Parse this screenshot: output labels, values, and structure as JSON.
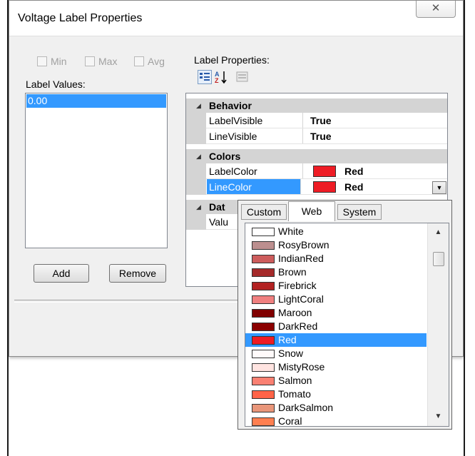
{
  "window": {
    "title": "Voltage Label Properties",
    "close_glyph": "✕"
  },
  "checkboxes": [
    {
      "label": "Min",
      "checked": false,
      "enabled": false
    },
    {
      "label": "Max",
      "checked": false,
      "enabled": false
    },
    {
      "label": "Avg",
      "checked": false,
      "enabled": false
    }
  ],
  "label_values": {
    "heading": "Label Values:",
    "items": [
      "0.00"
    ],
    "selected_index": 0
  },
  "buttons": {
    "add": "Add",
    "remove": "Remove"
  },
  "label_properties": {
    "heading": "Label Properties:",
    "toolbar": [
      "categorized-icon",
      "alphabetical-sort-icon",
      "property-pages-icon"
    ]
  },
  "property_grid": {
    "categories": [
      {
        "name": "Behavior",
        "props": [
          {
            "name": "LabelVisible",
            "value": "True"
          },
          {
            "name": "LineVisible",
            "value": "True"
          }
        ]
      },
      {
        "name": "Colors",
        "props": [
          {
            "name": "LabelColor",
            "value": "Red",
            "swatch": "#ee1c25"
          },
          {
            "name": "LineColor",
            "value": "Red",
            "swatch": "#ee1c25",
            "selected": true
          }
        ]
      },
      {
        "name": "Dat",
        "props": [
          {
            "name": "Valu",
            "value": ""
          }
        ]
      }
    ]
  },
  "color_picker": {
    "tabs": [
      "Custom",
      "Web",
      "System"
    ],
    "active_tab": "Web",
    "colors": [
      {
        "name": "White",
        "hex": "#ffffff"
      },
      {
        "name": "RosyBrown",
        "hex": "#bc8f8f"
      },
      {
        "name": "IndianRed",
        "hex": "#cd5c5c"
      },
      {
        "name": "Brown",
        "hex": "#a52a2a"
      },
      {
        "name": "Firebrick",
        "hex": "#b22222"
      },
      {
        "name": "LightCoral",
        "hex": "#f08080"
      },
      {
        "name": "Maroon",
        "hex": "#800000"
      },
      {
        "name": "DarkRed",
        "hex": "#8b0000"
      },
      {
        "name": "Red",
        "hex": "#ee1c25"
      },
      {
        "name": "Snow",
        "hex": "#fffafa"
      },
      {
        "name": "MistyRose",
        "hex": "#ffe4e1"
      },
      {
        "name": "Salmon",
        "hex": "#fa8072"
      },
      {
        "name": "Tomato",
        "hex": "#ff6347"
      },
      {
        "name": "DarkSalmon",
        "hex": "#e9967a"
      },
      {
        "name": "Coral",
        "hex": "#ff7f50"
      }
    ],
    "selected": "Red"
  }
}
